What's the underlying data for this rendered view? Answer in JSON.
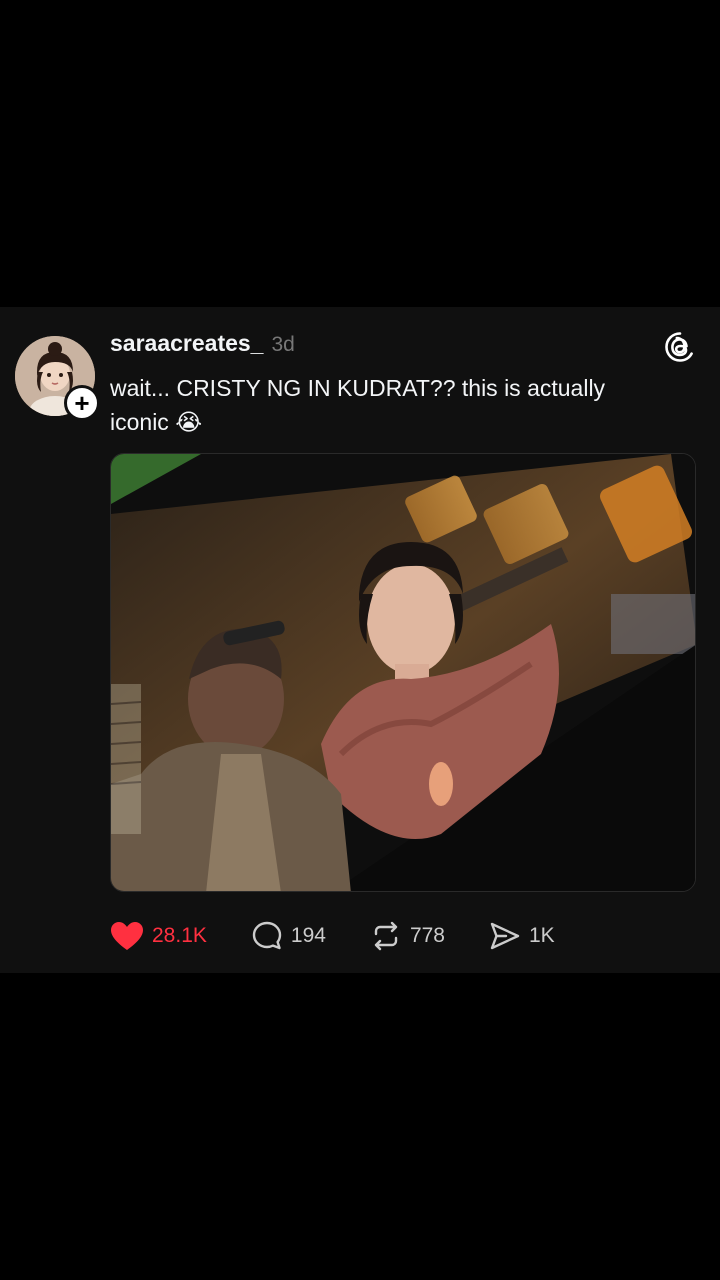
{
  "post": {
    "username": "saraacreates_",
    "timestamp": "3d",
    "text": "wait... CRISTY NG IN KUDRAT?? this is actually iconic 😭",
    "follow_badge": "+",
    "media_icon": "film-still-image"
  },
  "actions": {
    "like": {
      "count": "28.1K",
      "liked": true,
      "icon": "heart-icon"
    },
    "reply": {
      "count": "194",
      "icon": "comment-icon"
    },
    "repost": {
      "count": "778",
      "icon": "repost-icon"
    },
    "share": {
      "count": "1K",
      "icon": "send-icon"
    }
  },
  "colors": {
    "card_bg": "#101010",
    "page_bg": "#000000",
    "like_red": "#ff3040",
    "text": "#f3f5f7",
    "muted": "#777777"
  }
}
